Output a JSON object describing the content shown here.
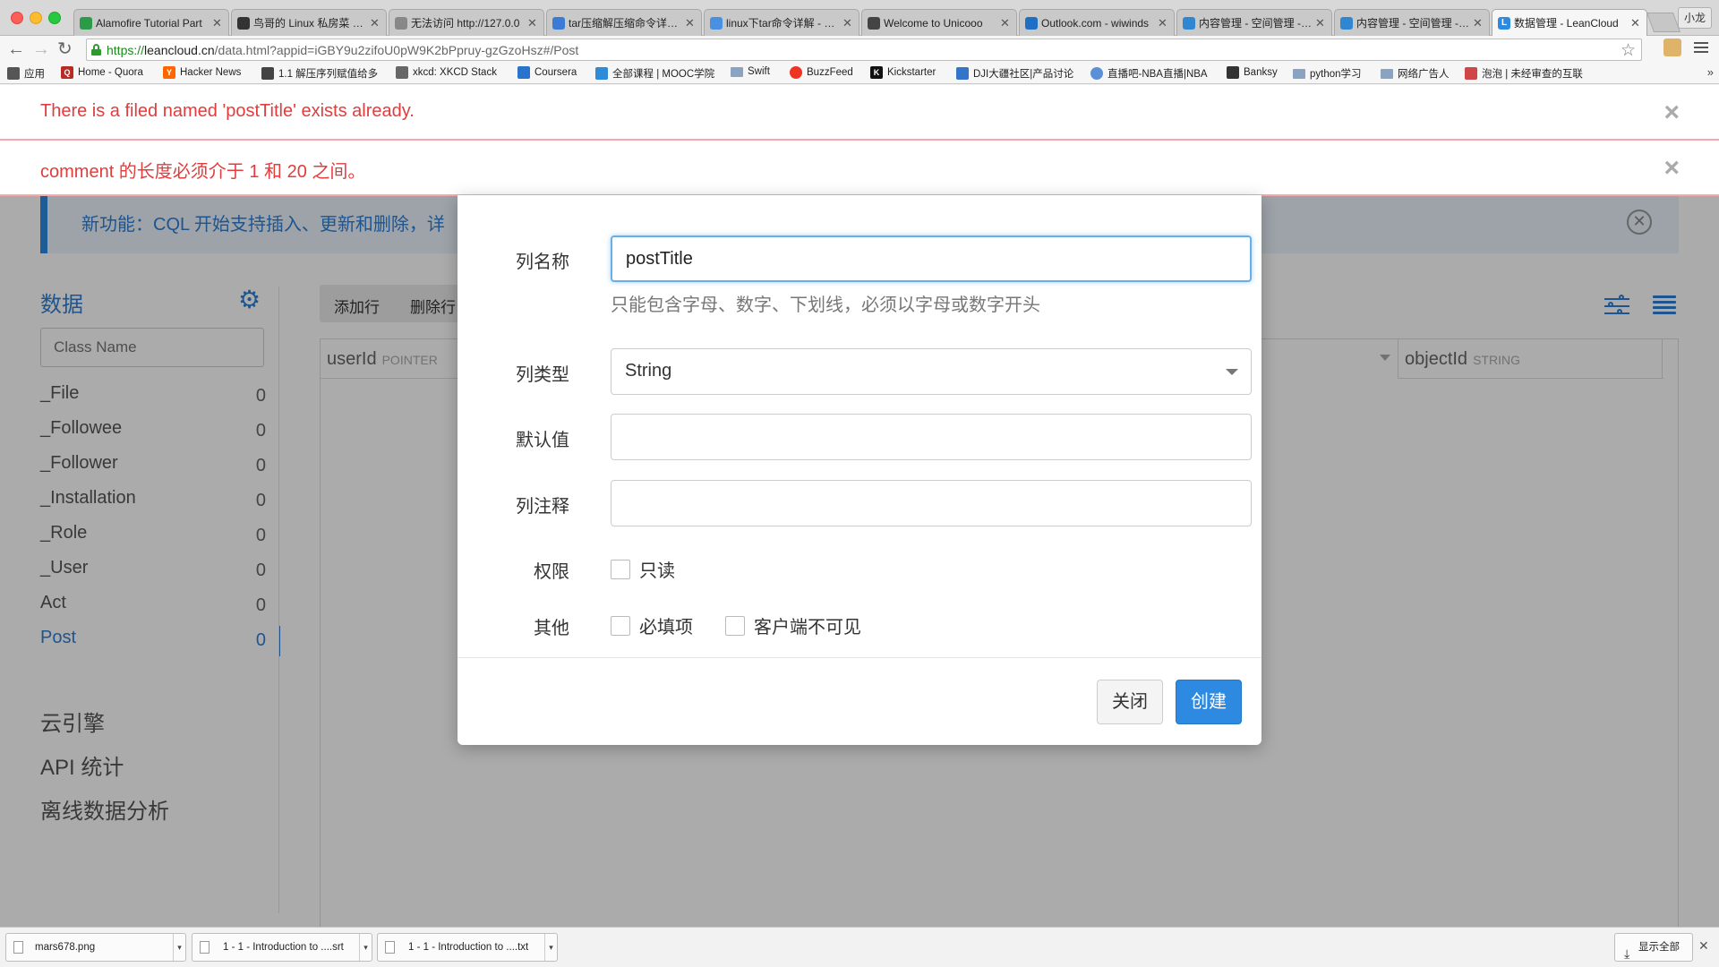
{
  "browser": {
    "tabs": [
      {
        "label": "Alamofire Tutorial Part",
        "icon_color": "#2b9b48"
      },
      {
        "label": "鸟哥的 Linux 私房菜 -- 鸟",
        "icon_color": "#333333"
      },
      {
        "label": "无法访问 http://127.0.0",
        "icon_color": "#888888"
      },
      {
        "label": "tar压缩解压缩命令详解 -",
        "icon_color": "#3a7bd5"
      },
      {
        "label": "linux下tar命令详解 - wfy",
        "icon_color": "#4a90e2"
      },
      {
        "label": "Welcome to Unicooo",
        "icon_color": "#444444"
      },
      {
        "label": "Outlook.com - wiwinds",
        "icon_color": "#1f6fc5"
      },
      {
        "label": "内容管理 - 空间管理 - 七",
        "icon_color": "#2f86d1"
      },
      {
        "label": "内容管理 - 空间管理 - 七",
        "icon_color": "#2f86d1"
      },
      {
        "label": "数据管理 - LeanCloud",
        "icon_color": "#2d8ae0"
      }
    ],
    "profile_label": "小龙",
    "url_scheme": "https://",
    "url_host": "leancloud.cn",
    "url_path": "/data.html?appid=iGBY9u2zifoU0pW9K2bPpruy-gzGzoHsz#/Post",
    "bookmarks": [
      {
        "label": "应用",
        "icon_color": "#555555"
      },
      {
        "label": "Home - Quora",
        "icon_color": "#b92b27"
      },
      {
        "label": "Hacker News",
        "icon_color": "#ff6600"
      },
      {
        "label": "1.1 解压序列赋值给多",
        "icon_color": "#444444"
      },
      {
        "label": "xkcd: XKCD Stack",
        "icon_color": "#666666"
      },
      {
        "label": "Coursera",
        "icon_color": "#2a73cc"
      },
      {
        "label": "全部课程 | MOOC学院",
        "icon_color": "#2e8bd8"
      },
      {
        "label": "Swift",
        "icon_color": "#8aa3c2"
      },
      {
        "label": "BuzzFeed",
        "icon_color": "#ee3322"
      },
      {
        "label": "Kickstarter",
        "icon_color": "#111111"
      },
      {
        "label": "DJI大疆社区|产品讨论",
        "icon_color": "#3575c9"
      },
      {
        "label": "直播吧-NBA直播|NBA",
        "icon_color": "#5b8fd6"
      },
      {
        "label": "Banksy",
        "icon_color": "#333333"
      },
      {
        "label": "python学习",
        "icon_color": "#8aa3c2"
      },
      {
        "label": "网络广告人",
        "icon_color": "#8aa3c2"
      },
      {
        "label": "泡泡 | 未经审查的互联",
        "icon_color": "#d04545"
      }
    ]
  },
  "alerts": [
    {
      "text": "There is a filed named 'postTitle' exists already."
    },
    {
      "text": "comment 的长度必须介于 1 和 20 之间。"
    }
  ],
  "banner": {
    "text": "新功能：CQL 开始支持插入、更新和删除，详"
  },
  "sidebar": {
    "title": "数据",
    "class_placeholder": "Class Name",
    "classes": [
      {
        "name": "_File",
        "count": "0"
      },
      {
        "name": "_Followee",
        "count": "0"
      },
      {
        "name": "_Follower",
        "count": "0"
      },
      {
        "name": "_Installation",
        "count": "0"
      },
      {
        "name": "_Role",
        "count": "0"
      },
      {
        "name": "_User",
        "count": "0"
      },
      {
        "name": "Act",
        "count": "0"
      },
      {
        "name": "Post",
        "count": "0"
      }
    ],
    "sections": [
      "云引擎",
      "API 统计",
      "离线数据分析"
    ]
  },
  "table": {
    "add_row": "添加行",
    "delete_row": "删除行",
    "columns": [
      {
        "name": "userId",
        "type": "POINTER"
      },
      {
        "name": "objectId",
        "type": "STRING"
      }
    ]
  },
  "modal": {
    "name_label": "列名称",
    "name_value": "postTitle",
    "name_help": "只能包含字母、数字、下划线，必须以字母或数字开头",
    "type_label": "列类型",
    "type_value": "String",
    "default_label": "默认值",
    "comment_label": "列注释",
    "permission_label": "权限",
    "readonly_label": "只读",
    "other_label": "其他",
    "required_label": "必填项",
    "client_hidden_label": "客户端不可见",
    "close_label": "关闭",
    "create_label": "创建"
  },
  "downloads": {
    "items": [
      {
        "name": "mars678.png"
      },
      {
        "name": "1 - 1 - Introduction to ....srt"
      },
      {
        "name": "1 - 1 - Introduction to ....txt"
      }
    ],
    "show_all": "显示全部"
  },
  "colors": {
    "accent": "#2d8ae0",
    "error": "#e23c3c"
  }
}
